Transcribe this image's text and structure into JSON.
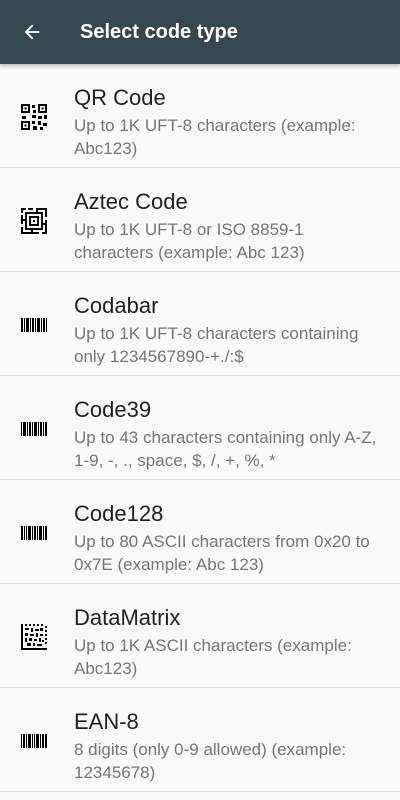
{
  "app_bar": {
    "title": "Select code type",
    "back_icon": "arrow-back-icon"
  },
  "colors": {
    "app_bar_bg": "#37474f",
    "title_text": "#212121",
    "secondary_text": "#757575",
    "divider": "#dcdcdc"
  },
  "code_types": [
    {
      "title": "QR Code",
      "description": "Up to 1K UFT-8 characters (example: Abc123)",
      "icon": "qr-code-icon"
    },
    {
      "title": "Aztec Code",
      "description": "Up to 1K UFT-8 or ISO 8859-1 characters (example: Abc 123)",
      "icon": "aztec-code-icon"
    },
    {
      "title": "Codabar",
      "description": "Up to 1K UFT-8 characters containing only 1234567890-+./:$",
      "icon": "barcode-icon"
    },
    {
      "title": "Code39",
      "description": "Up to 43 characters containing only A-Z, 1-9, -, ., space, $, /, +, %, *",
      "icon": "barcode-icon"
    },
    {
      "title": "Code128",
      "description": "Up to 80 ASCII characters from 0x20 to 0x7E (example: Abc 123)",
      "icon": "barcode-icon"
    },
    {
      "title": "DataMatrix",
      "description": "Up to 1K ASCII characters (example: Abc123)",
      "icon": "data-matrix-icon"
    },
    {
      "title": "EAN-8",
      "description": "8 digits (only 0-9 allowed) (example: 12345678)",
      "icon": "barcode-icon"
    }
  ]
}
